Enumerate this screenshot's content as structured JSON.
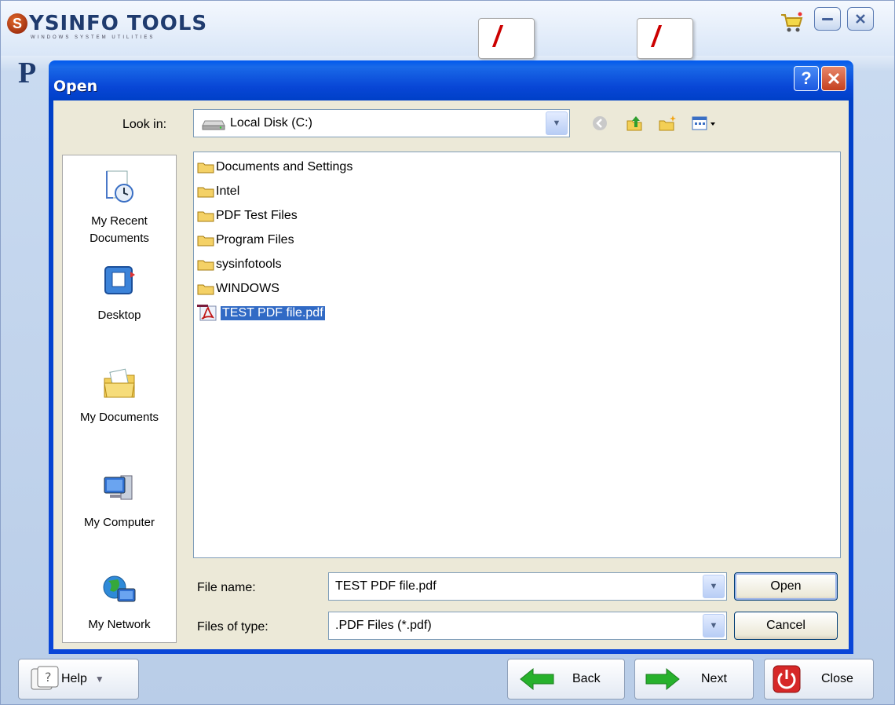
{
  "app": {
    "logo_letter": "S",
    "logo_text": "YSINFO TOOLS",
    "tagline": "WINDOWS SYSTEM UTILITIES",
    "title_partial": "P",
    "toolbar": {
      "help_label": "Help",
      "back_label": "Back",
      "next_label": "Next",
      "close_label": "Close"
    }
  },
  "dialog": {
    "title": "Open",
    "help_glyph": "?",
    "look_in": {
      "label": "Look in:",
      "value": "Local Disk (C:)"
    },
    "places": [
      {
        "label_1": "My Recent",
        "label_2": "Documents"
      },
      {
        "label_1": "Desktop"
      },
      {
        "label_1": "My Documents"
      },
      {
        "label_1": "My Computer"
      },
      {
        "label_1": "My Network"
      }
    ],
    "files": [
      {
        "name": "Documents and Settings",
        "type": "folder"
      },
      {
        "name": "Intel",
        "type": "folder"
      },
      {
        "name": "PDF Test Files",
        "type": "folder"
      },
      {
        "name": "Program Files",
        "type": "folder"
      },
      {
        "name": "sysinfotools",
        "type": "folder"
      },
      {
        "name": "WINDOWS",
        "type": "folder"
      },
      {
        "name": "TEST PDF file.pdf",
        "type": "pdf",
        "selected": true
      }
    ],
    "file_name": {
      "label": "File name:",
      "value": "TEST PDF file.pdf"
    },
    "file_type": {
      "label": "Files of type:",
      "value": ".PDF Files (*.pdf)"
    },
    "open_label": "Open",
    "cancel_label": "Cancel"
  },
  "colors": {
    "titlebar": "#0a46d8",
    "dialog_face": "#ece9d8",
    "selection": "#316ac5"
  }
}
